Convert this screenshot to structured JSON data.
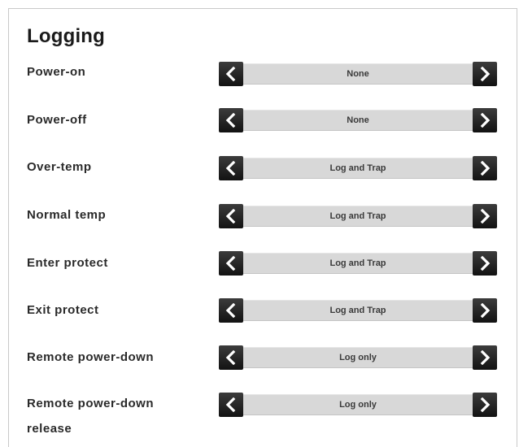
{
  "section": {
    "title": "Logging"
  },
  "rows": [
    {
      "label": "Power-on",
      "value": "None"
    },
    {
      "label": "Power-off",
      "value": "None"
    },
    {
      "label": "Over-temp",
      "value": "Log and Trap"
    },
    {
      "label": "Normal temp",
      "value": "Log and Trap"
    },
    {
      "label": "Enter protect",
      "value": "Log and Trap"
    },
    {
      "label": "Exit protect",
      "value": "Log and Trap"
    },
    {
      "label": "Remote power-down",
      "value": "Log only"
    },
    {
      "label_line1": "Remote power-down",
      "label_line2": "release",
      "value": "Log only"
    }
  ],
  "icons": {
    "previous": "chevron-left-icon",
    "next": "chevron-right-icon"
  },
  "colors": {
    "button_bg": "#1a1a1a",
    "track_bg": "#d8d8d8",
    "text": "#2a2a2a"
  }
}
